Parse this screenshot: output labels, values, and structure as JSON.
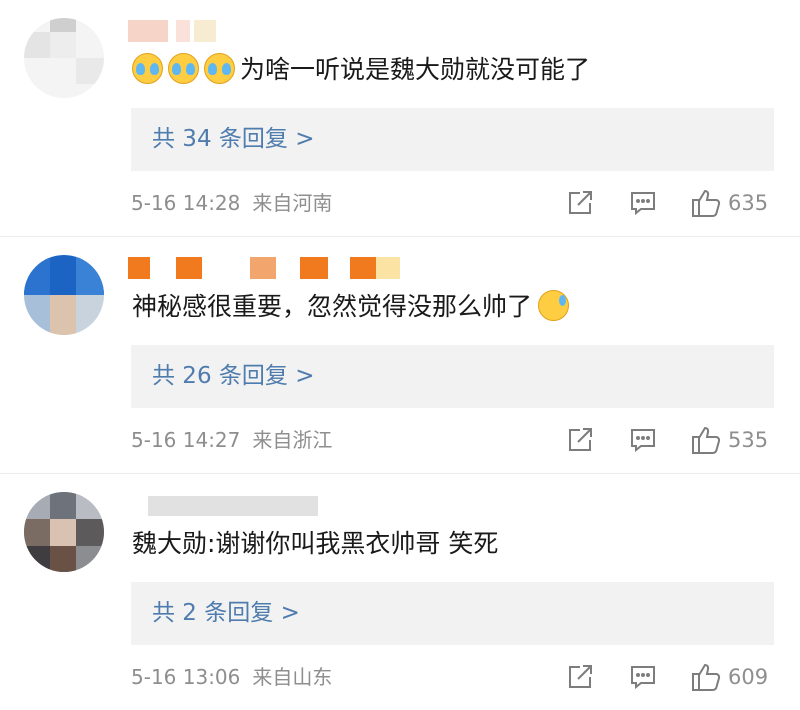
{
  "comments": [
    {
      "text": "为啥一听说是魏大勋就没可能了",
      "leading_emoji": [
        "cry-laugh-icon",
        "cry-laugh-icon",
        "cry-laugh-icon"
      ],
      "replies_label": "共 34 条回复 >",
      "time": "5-16 14:28",
      "location": "来自河南",
      "likes": "635"
    },
    {
      "text": "神秘感很重要，忽然觉得没那么帅了",
      "trailing_emoji": "sweat-icon",
      "replies_label": "共 26 条回复 >",
      "time": "5-16 14:27",
      "location": "来自浙江",
      "likes": "535"
    },
    {
      "text": "魏大勋:谢谢你叫我黑衣帅哥 笑死",
      "replies_label": "共 2 条回复 >",
      "time": "5-16 13:06",
      "location": "来自山东",
      "likes": "609"
    }
  ],
  "colors": {
    "reply_link": "#4f7cae",
    "reply_bg": "#f2f2f2",
    "meta_text": "#8e8e8e",
    "name_orange": "#f07a1d"
  }
}
